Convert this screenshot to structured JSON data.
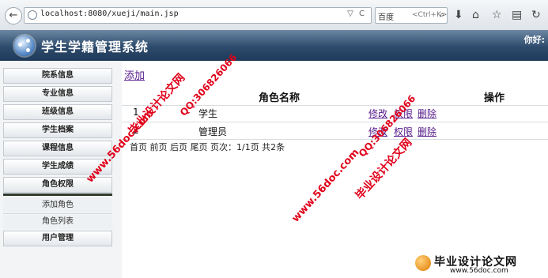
{
  "browser": {
    "url": "localhost:8080/xueji/main.jsp",
    "search_engine": "百度",
    "search_hint": "<Ctrl+K>",
    "back_glyph": "←",
    "url_icons": "▽ C",
    "search_glyph": "⌕",
    "download_glyph": "⬇",
    "home_glyph": "⌂",
    "bookmark_glyph": "☆",
    "library_glyph": "▤",
    "sync_glyph": "↻"
  },
  "header": {
    "title": "学生学籍管理系统",
    "greeting": "你好:"
  },
  "sidebar": {
    "items": [
      {
        "label": "院系信息"
      },
      {
        "label": "专业信息"
      },
      {
        "label": "班级信息"
      },
      {
        "label": "学生档案"
      },
      {
        "label": "课程信息"
      },
      {
        "label": "学生成绩"
      },
      {
        "label": "角色权限"
      }
    ],
    "sub_items": [
      {
        "label": "添加角色"
      },
      {
        "label": "角色列表"
      }
    ],
    "last_item": {
      "label": "用户管理"
    }
  },
  "main": {
    "add_label": "添加",
    "columns": [
      "角色名称",
      "操作"
    ],
    "rows": [
      {
        "id": "1",
        "name": "学生",
        "actions": [
          "修改",
          "权限",
          "删除"
        ]
      },
      {
        "id": "2",
        "name": "管理员",
        "actions": [
          "修改",
          "权限",
          "删除"
        ]
      }
    ],
    "pager": "首页 前页 后页 尾页 页次：1/1页 共2条"
  },
  "watermarks": {
    "site_cn": "毕业设计论文网",
    "site_url": "www.56doc.com",
    "qq": "QQ:306826066",
    "logo_text": "毕业设计论文网",
    "logo_url": "www.56doc.com"
  },
  "colors": {
    "header_dark": "#1f3a59",
    "link": "#551a8b",
    "watermark": "#e0001a"
  }
}
